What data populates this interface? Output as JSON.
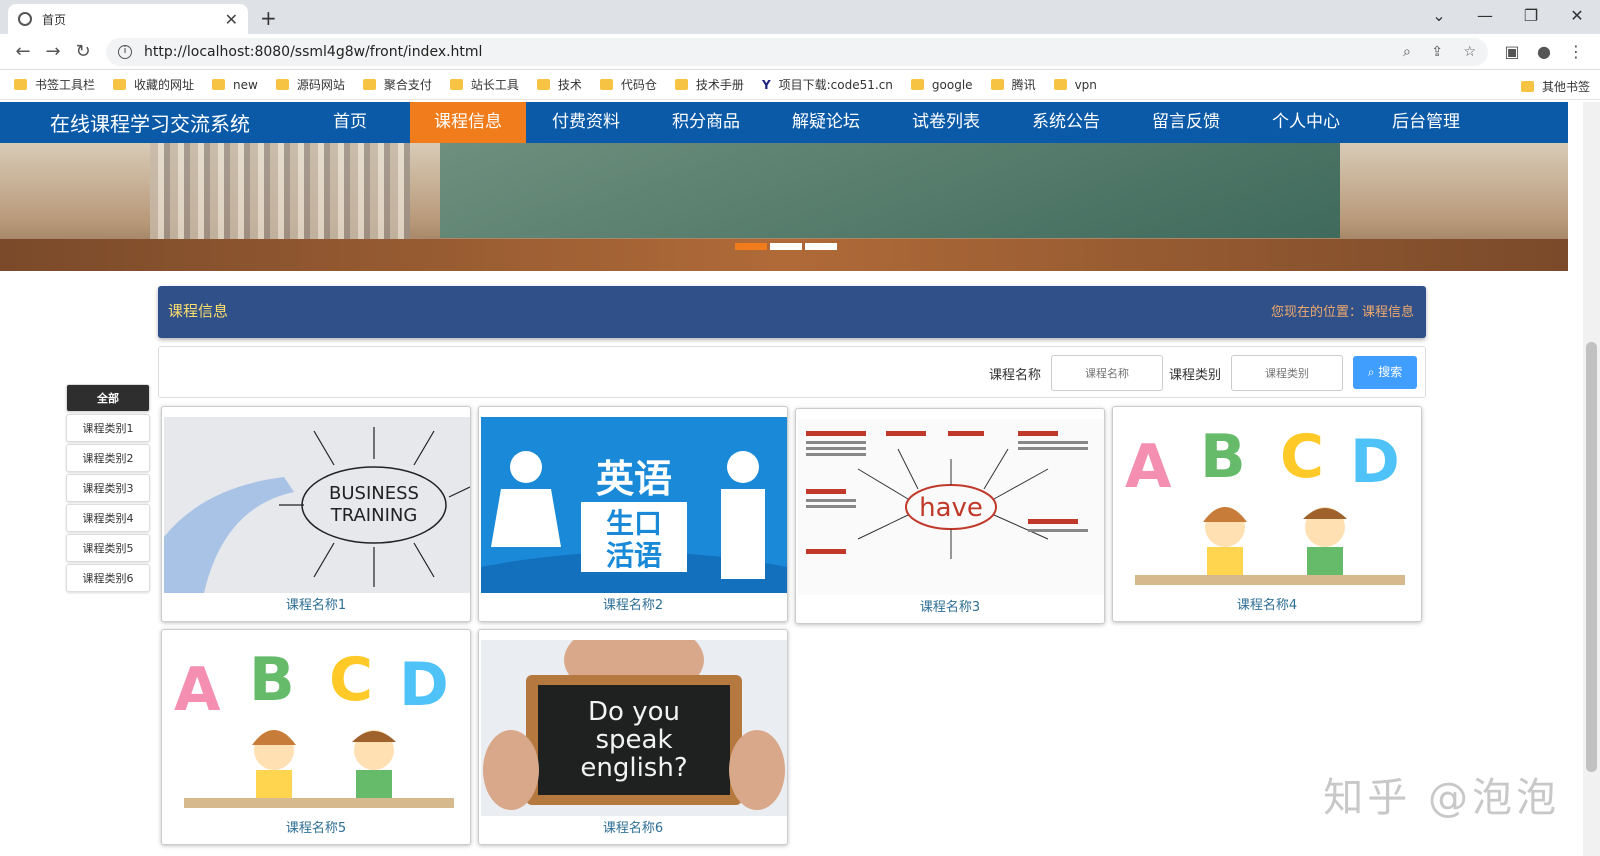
{
  "browser": {
    "tab_title": "首页",
    "url": "http://localhost:8080/ssml4g8w/front/index.html",
    "bookmarks": [
      "书签工具栏",
      "收藏的网址",
      "new",
      "源码网站",
      "聚合支付",
      "站长工具",
      "技术",
      "代码仓",
      "技术手册",
      "项目下载:code51.cn",
      "google",
      "腾讯",
      "vpn"
    ],
    "bookmarks_right": "其他书签"
  },
  "site": {
    "logo": "在线课程学习交流系统",
    "menu": [
      "首页",
      "课程信息",
      "付费资料",
      "积分商品",
      "解疑论坛",
      "试卷列表",
      "系统公告",
      "留言反馈",
      "个人中心",
      "后台管理"
    ],
    "active_menu": "课程信息"
  },
  "crumb": {
    "title": "课程信息",
    "position": "您现在的位置：课程信息"
  },
  "search": {
    "name_label": "课程名称",
    "name_placeholder": "课程名称",
    "type_label": "课程类别",
    "type_placeholder": "课程类别",
    "button": "搜索"
  },
  "categories": [
    "全部",
    "课程类别1",
    "课程类别2",
    "课程类别3",
    "课程类别4",
    "课程类别5",
    "课程类别6"
  ],
  "courses": [
    {
      "name": "课程名称1",
      "image": "business-training"
    },
    {
      "name": "课程名称2",
      "image": "english-spoken"
    },
    {
      "name": "课程名称3",
      "image": "have-mindmap"
    },
    {
      "name": "课程名称4",
      "image": "abcd-kids"
    },
    {
      "name": "课程名称5",
      "image": "abcd-kids"
    },
    {
      "name": "课程名称6",
      "image": "do-you-speak-english"
    }
  ],
  "image_text": {
    "business": [
      "BUSINESS",
      "TRAINING"
    ],
    "english": [
      "英语",
      "生口",
      "活语"
    ],
    "have": "have",
    "abcd": [
      "A",
      "B",
      "C",
      "D"
    ],
    "speak": [
      "Do you",
      "speak",
      "english?"
    ]
  },
  "watermark": "知乎 @泡泡"
}
